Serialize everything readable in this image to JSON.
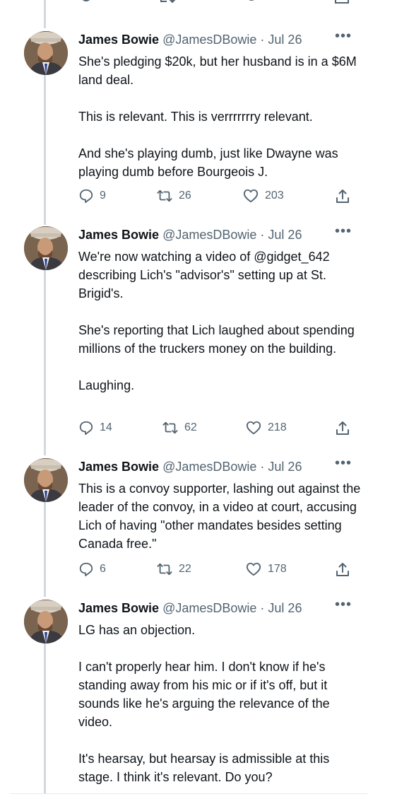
{
  "tweets": [
    {
      "name": "James Bowie",
      "handle": "@JamesDBowie",
      "separator": "·",
      "date": "Jul 26",
      "more": "•••",
      "paragraphs": [
        "She's pledging $20k, but her husband is in a $6M land deal.",
        "This is relevant.  This is verrrrrrry relevant.",
        "And she's playing dumb, just like Dwayne was playing dumb before Bourgeois J."
      ],
      "replies": "9",
      "retweets": "26",
      "likes": "203"
    },
    {
      "name": "James Bowie",
      "handle": "@JamesDBowie",
      "separator": "·",
      "date": "Jul 26",
      "more": "•••",
      "paragraphs": [
        "We're now watching a video of @gidget_642 describing Lich's \"advisor's\" setting up at St. Brigid's.",
        "She's reporting that Lich laughed about spending millions of the truckers money on the building.",
        "Laughing."
      ],
      "replies": "14",
      "retweets": "62",
      "likes": "218"
    },
    {
      "name": "James Bowie",
      "handle": "@JamesDBowie",
      "separator": "·",
      "date": "Jul 26",
      "more": "•••",
      "paragraphs": [
        "This is a convoy supporter, lashing out against the leader of the convoy, in a video at court, accusing Lich of having \"other mandates besides setting Canada free.\""
      ],
      "replies": "6",
      "retweets": "22",
      "likes": "178"
    },
    {
      "name": "James Bowie",
      "handle": "@JamesDBowie",
      "separator": "·",
      "date": "Jul 26",
      "more": "•••",
      "paragraphs": [
        "LG has an objection.",
        "I can't properly hear him.  I don't know if he's standing away from his mic or if it's off, but it sounds like he's arguing the relevance of the video.",
        "It's hearsay, but hearsay is admissible at this stage.  I think it's relevant.  Do you?"
      ]
    }
  ],
  "icons": {
    "reply": "reply-icon",
    "retweet": "retweet-icon",
    "like": "heart-icon",
    "share": "share-icon"
  },
  "colors": {
    "text": "#0f1419",
    "secondary": "#536471",
    "thread_line": "#cfd9de"
  }
}
